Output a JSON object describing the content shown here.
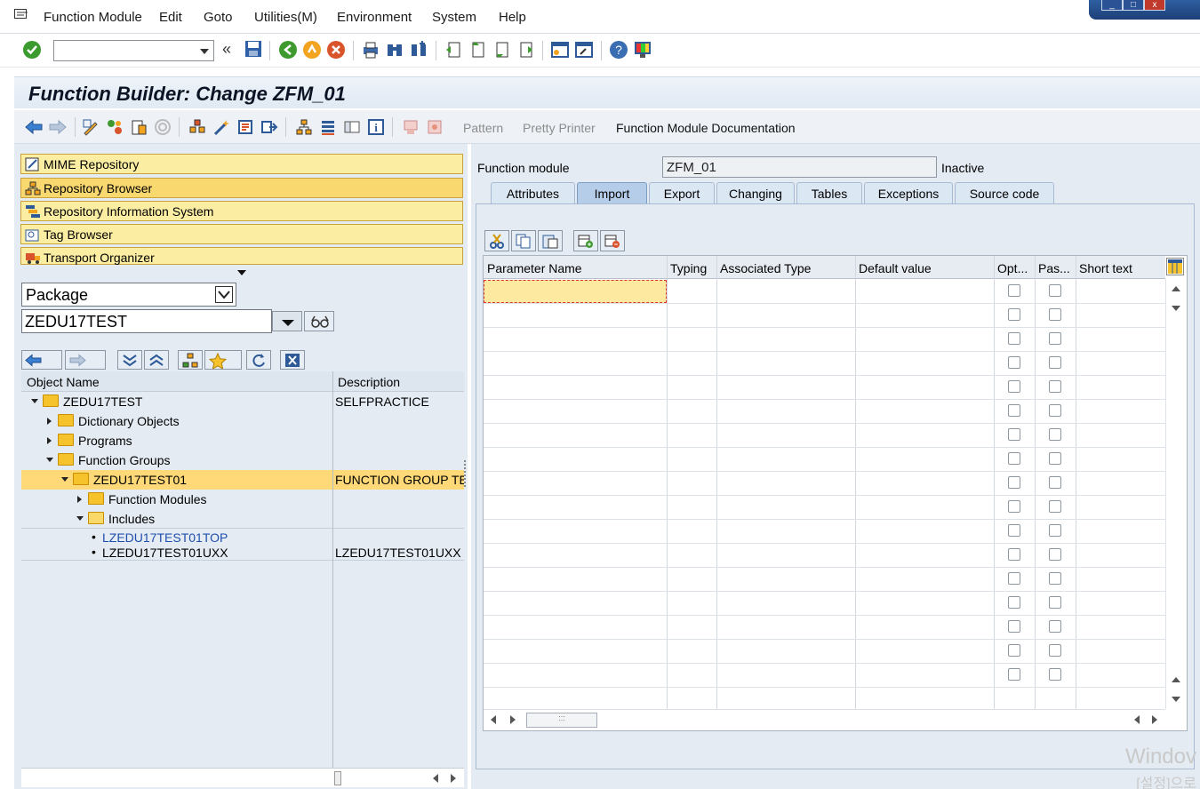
{
  "menu": {
    "items": [
      "Function Module",
      "Edit",
      "Goto",
      "Utilities(M)",
      "Environment",
      "System",
      "Help"
    ]
  },
  "title": "Function Builder: Change ZFM_01",
  "app_toolbar": {
    "pattern": "Pattern",
    "pretty_printer": "Pretty Printer",
    "fm_doc": "Function Module Documentation"
  },
  "nav": {
    "buttons": [
      "MIME Repository",
      "Repository Browser",
      "Repository Information System",
      "Tag Browser",
      "Transport Organizer"
    ]
  },
  "browser": {
    "object_type": "Package",
    "object_name": "ZEDU17TEST"
  },
  "tree": {
    "headers": {
      "name": "Object Name",
      "desc": "Description"
    },
    "rows": [
      {
        "name": "ZEDU17TEST",
        "desc": "SELFPRACTICE"
      },
      {
        "name": "Dictionary Objects",
        "desc": ""
      },
      {
        "name": "Programs",
        "desc": ""
      },
      {
        "name": "Function Groups",
        "desc": ""
      },
      {
        "name": "ZEDU17TEST01",
        "desc": "FUNCTION GROUP TE"
      },
      {
        "name": "Function Modules",
        "desc": ""
      },
      {
        "name": "Includes",
        "desc": ""
      },
      {
        "name": "LZEDU17TEST01TOP",
        "desc": ""
      },
      {
        "name": "LZEDU17TEST01UXX",
        "desc": "LZEDU17TEST01UXX"
      }
    ]
  },
  "fm": {
    "label": "Function module",
    "value": "ZFM_01",
    "status": "Inactive"
  },
  "tabs": [
    "Attributes",
    "Import",
    "Export",
    "Changing",
    "Tables",
    "Exceptions",
    "Source code"
  ],
  "active_tab": "Import",
  "grid": {
    "headers": [
      "Parameter Name",
      "Typing",
      "Associated Type",
      "Default value",
      "Opt...",
      "Pas...",
      "Short text"
    ],
    "row_count": 17
  },
  "watermark": {
    "line1": "Windov",
    "line2": "[설정]으로"
  },
  "colors": {
    "nav_yellow": "#fbeea2",
    "selected_row": "#ffd877",
    "title_bg": "#e1e9f3"
  }
}
